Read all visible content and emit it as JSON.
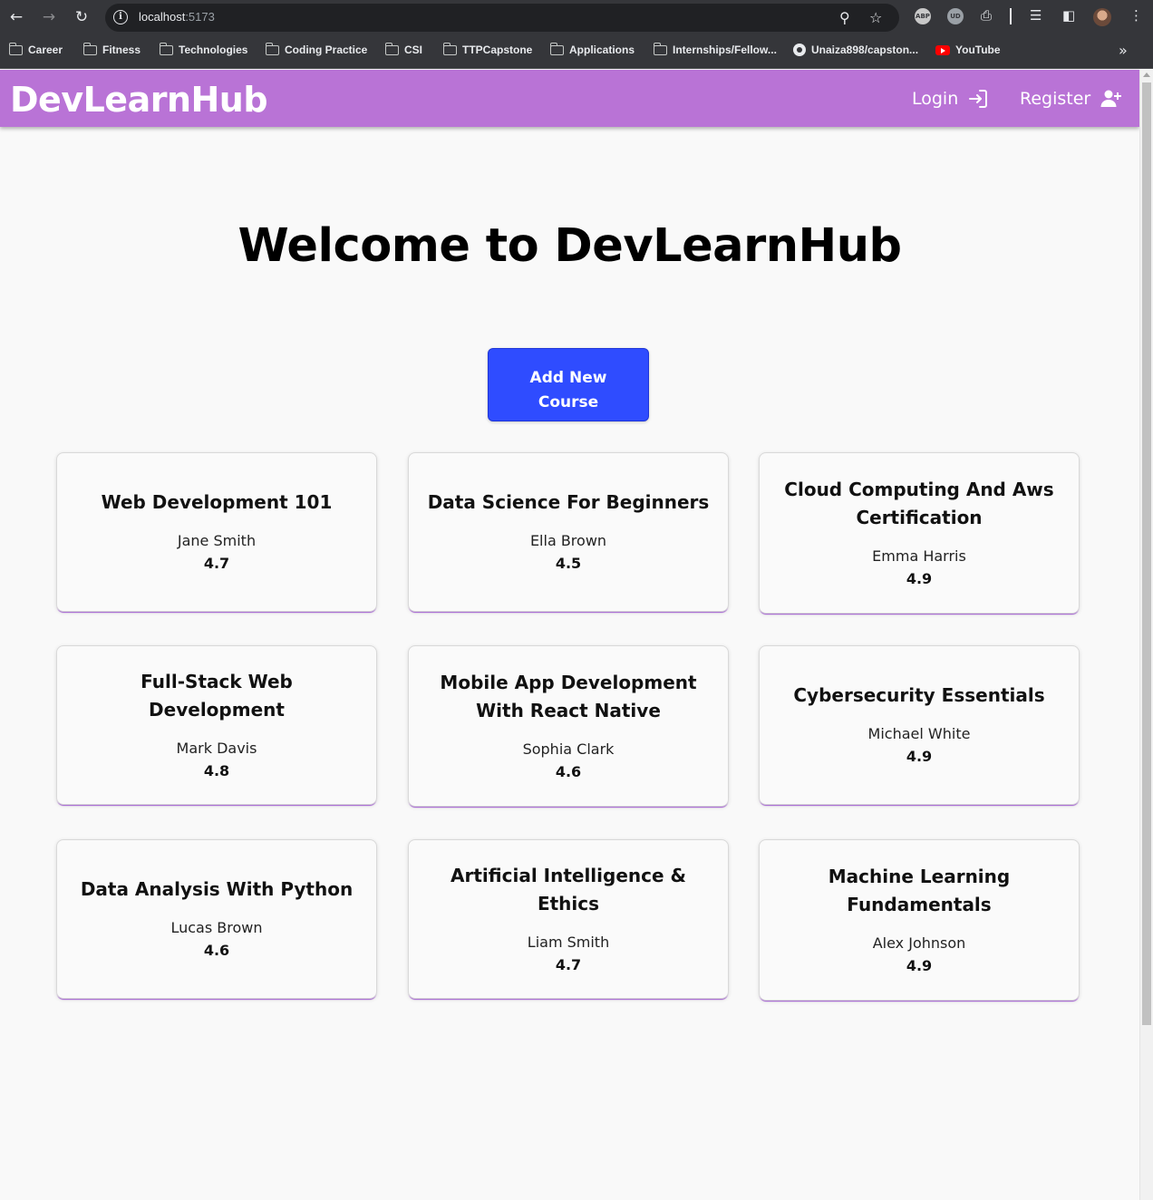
{
  "browser": {
    "url_host": "localhost",
    "url_port": ":5173",
    "bookmarks": [
      {
        "label": "Career",
        "icon": "folder-icon"
      },
      {
        "label": "Fitness",
        "icon": "folder-icon"
      },
      {
        "label": "Technologies",
        "icon": "folder-icon"
      },
      {
        "label": "Coding Practice",
        "icon": "folder-icon"
      },
      {
        "label": "CSI",
        "icon": "folder-icon"
      },
      {
        "label": "TTPCapstone",
        "icon": "folder-icon"
      },
      {
        "label": "Applications",
        "icon": "folder-icon"
      },
      {
        "label": "Internships/Fellow...",
        "icon": "folder-icon"
      },
      {
        "label": "Unaiza898/capston...",
        "icon": "github-icon"
      },
      {
        "label": "YouTube",
        "icon": "youtube-icon"
      }
    ],
    "extensions": [
      "ABP",
      "UD"
    ]
  },
  "navbar": {
    "brand": "DevLearnHub",
    "login_label": "Login",
    "register_label": "Register",
    "accent_color": "#b973d6"
  },
  "main": {
    "title": "Welcome to DevLearnHub",
    "add_button_label": "Add New Course",
    "button_color": "#2f4cff"
  },
  "courses": [
    {
      "title": "Web Development 101",
      "instructor": "Jane Smith",
      "rating": "4.7"
    },
    {
      "title": "Data Science For Beginners",
      "instructor": "Ella Brown",
      "rating": "4.5"
    },
    {
      "title": "Cloud Computing And Aws Certification",
      "instructor": "Emma Harris",
      "rating": "4.9"
    },
    {
      "title": "Full-Stack Web Development",
      "instructor": "Mark Davis",
      "rating": "4.8"
    },
    {
      "title": "Mobile App Development With React Native",
      "instructor": "Sophia Clark",
      "rating": "4.6"
    },
    {
      "title": "Cybersecurity Essentials",
      "instructor": "Michael White",
      "rating": "4.9"
    },
    {
      "title": "Data Analysis With Python",
      "instructor": "Lucas Brown",
      "rating": "4.6"
    },
    {
      "title": "Artificial Intelligence & Ethics",
      "instructor": "Liam Smith",
      "rating": "4.7"
    },
    {
      "title": "Machine Learning Fundamentals",
      "instructor": "Alex Johnson",
      "rating": "4.9"
    }
  ]
}
